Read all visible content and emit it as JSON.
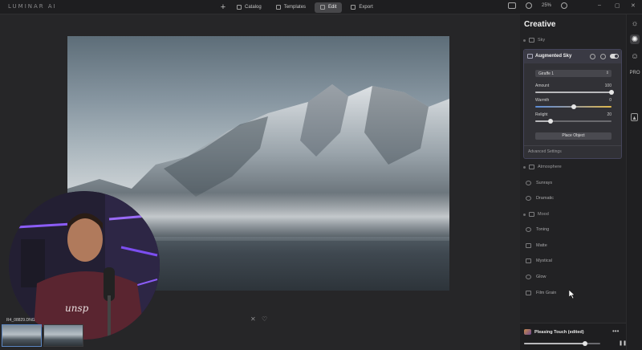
{
  "app": {
    "logo": "LUMINAR AI"
  },
  "topbar": {
    "add_label": "+",
    "nav": [
      {
        "label": "Catalog",
        "icon": "catalog-icon"
      },
      {
        "label": "Templates",
        "icon": "templates-icon"
      },
      {
        "label": "Edit",
        "icon": "edit-icon",
        "active": true
      },
      {
        "label": "Export",
        "icon": "export-icon"
      }
    ],
    "zoom": "25%",
    "window_controls": [
      "–",
      "▢",
      "✕"
    ]
  },
  "canvas": {
    "below_icons": [
      "✕",
      "♡"
    ]
  },
  "filmstrip": {
    "filename": "R4_08829.DNG"
  },
  "panel": {
    "title": "Creative",
    "sky_section": "Sky",
    "augmented_sky": {
      "title": "Augmented Sky",
      "object_select": "Giraffe 1",
      "sliders": [
        {
          "label": "Amount",
          "value": "100",
          "level": 100,
          "type": "plain"
        },
        {
          "label": "Warmth",
          "value": "0",
          "level": 50,
          "type": "warm"
        },
        {
          "label": "Relight",
          "value": "20",
          "level": 20,
          "type": "plain"
        }
      ],
      "place_button": "Place Object",
      "advanced": "Advanced Settings"
    },
    "atmosphere_section": "Atmosphere",
    "atmosphere_items": [
      "Sunrays",
      "Dramatic"
    ],
    "mood_section": "Mood",
    "mood_items": [
      "Toning",
      "Matte",
      "Mystical",
      "Glow",
      "Film Grain"
    ],
    "preset": {
      "name": "Pleasing Touch (edited)",
      "more": "•••",
      "amount": 80
    }
  },
  "toolstrip": [
    "sun-icon",
    "palette-icon",
    "face-icon",
    "pro-icon",
    "local-masking-icon"
  ],
  "toolstrip_labels": {
    "pro": "PRO"
  },
  "colors": {
    "accent": "#5d88c4",
    "panel_bg": "#222224",
    "card_bg": "#313136"
  }
}
